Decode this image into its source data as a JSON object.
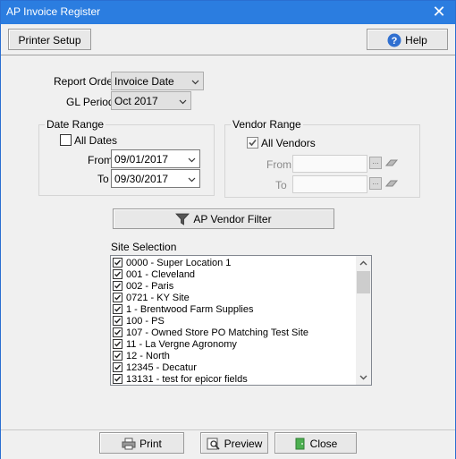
{
  "window": {
    "title": "AP Invoice Register",
    "close_glyph": "✕"
  },
  "toolbar": {
    "printer_setup": "Printer Setup",
    "help": "Help"
  },
  "report": {
    "report_order_label": "Report Order",
    "report_order_value": "Invoice Date",
    "gl_period_label": "GL Period",
    "gl_period_value": "Oct 2017"
  },
  "date_range": {
    "title": "Date Range",
    "all_dates_label": "All Dates",
    "all_dates_checked": false,
    "from_label": "From",
    "from_value": "09/01/2017",
    "to_label": "To",
    "to_value": "09/30/2017"
  },
  "vendor_range": {
    "title": "Vendor Range",
    "all_vendors_label": "All Vendors",
    "all_vendors_checked": true,
    "from_label": "From",
    "to_label": "To"
  },
  "filter": {
    "ap_vendor_filter": "AP Vendor Filter"
  },
  "site_selection": {
    "label": "Site Selection",
    "items": [
      "0000 - Super Location 1",
      "001 - Cleveland",
      "002 - Paris",
      "0721 - KY Site",
      "1 - Brentwood Farm Supplies",
      "100 - PS",
      "107 - Owned Store PO Matching Test Site",
      "11 - La Vergne Agronomy",
      "12 - North",
      "12345 - Decatur",
      "13131 - test for epicor fields"
    ]
  },
  "footer": {
    "print": "Print",
    "preview": "Preview",
    "close": "Close"
  },
  "icons": {
    "help": "help-icon",
    "filter": "funnel-icon",
    "print": "printer-icon",
    "preview": "magnifier-icon",
    "close": "door-icon"
  }
}
